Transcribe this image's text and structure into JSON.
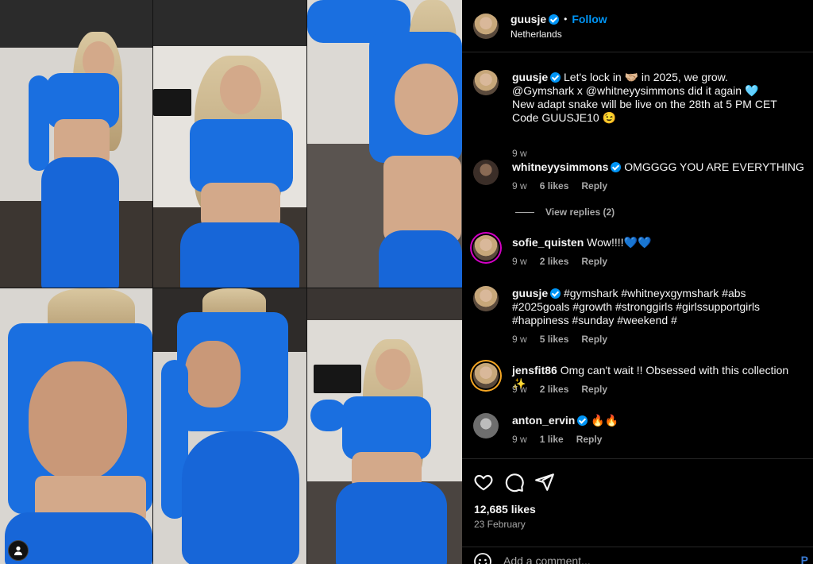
{
  "post": {
    "header": {
      "username": "guusje",
      "follow_label": "Follow",
      "separator": "•",
      "location": "Netherlands"
    },
    "caption": {
      "username": "guusje",
      "lines": [
        "Let's lock in 🤝🏼 in 2025, we grow.",
        "@Gymshark x @whitneyysimmons did it again 🩵",
        "New adapt snake will be live on the 28th at 5 PM CET",
        "Code GUUSJE10 😉"
      ],
      "age": "9 w"
    },
    "comments": [
      {
        "username": "whitneyysimmons",
        "verified": true,
        "text": "OMGGGG YOU ARE EVERYTHING",
        "age": "9 w",
        "likes": "6 likes",
        "reply_label": "Reply",
        "view_replies": "View replies (2)"
      },
      {
        "username": "sofie_quisten",
        "verified": false,
        "text": "Wow!!!!💙💙",
        "age": "9 w",
        "likes": "2 likes",
        "reply_label": "Reply"
      },
      {
        "username": "guusje",
        "verified": true,
        "text": "#gymshark #whitneyxgymshark #abs #2025goals #growth #stronggirls #girlssupportgirls #happiness #sunday #weekend #",
        "age": "9 w",
        "likes": "5 likes",
        "reply_label": "Reply"
      },
      {
        "username": "jensfit86",
        "verified": false,
        "text": "Omg can't wait !! Obsessed with this collection ✨",
        "age": "9 w",
        "likes": "2 likes",
        "reply_label": "Reply"
      },
      {
        "username": "anton_ervin",
        "verified": true,
        "text": "🔥🔥",
        "age": "9 w",
        "likes": "1 like",
        "reply_label": "Reply"
      }
    ],
    "likes_count": "12,685 likes",
    "date": "23 February",
    "comment_input": {
      "placeholder": "Add a comment...",
      "post_label": "P"
    },
    "icons": {
      "like": "heart-icon",
      "comment": "comment-icon",
      "share": "share-icon",
      "emoji": "smiley-icon",
      "verified": "verified-badge-icon"
    },
    "colors": {
      "accent": "#0095f6",
      "background": "#000000",
      "muted_text": "#a8a8a8",
      "outfit_blue": "#1a6fe0"
    }
  }
}
